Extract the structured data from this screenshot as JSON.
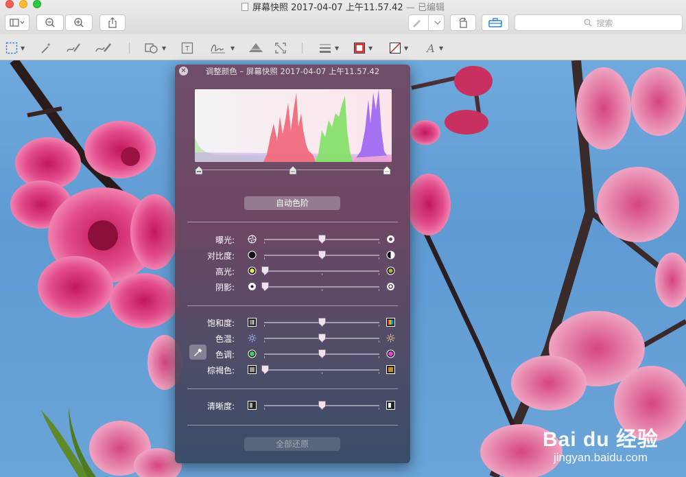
{
  "window": {
    "title": "屏幕快照 2017-04-07 上午11.57.42",
    "edited": " — 已编辑"
  },
  "toolbar": {
    "search_placeholder": "搜索"
  },
  "panel": {
    "title": "调整颜色 – 屏幕快照 2017-04-07 上午11.57.42",
    "auto_levels": "自动色阶",
    "reset_all": "全部还原",
    "levels": {
      "black": 0.0,
      "mid": 0.5,
      "white": 1.0
    },
    "sliders_group1": [
      {
        "label": "曝光:",
        "value": 0.5,
        "icon_left": "aperture-small-icon",
        "icon_right": "aperture-large-icon"
      },
      {
        "label": "对比度:",
        "value": 0.5,
        "icon_left": "contrast-low-icon",
        "icon_right": "contrast-high-icon"
      },
      {
        "label": "高光:",
        "value": 0.0,
        "icon_left": "highlight-bright-icon",
        "icon_right": "highlight-dim-icon"
      },
      {
        "label": "阴影:",
        "value": 0.0,
        "icon_left": "shadow-dark-icon",
        "icon_right": "shadow-light-icon"
      }
    ],
    "sliders_group2": [
      {
        "label": "饱和度:",
        "value": 0.5,
        "icon_left": "saturation-gray-icon",
        "icon_right": "saturation-color-icon"
      },
      {
        "label": "色温:",
        "value": 0.5,
        "icon_left": "temperature-cool-icon",
        "icon_right": "temperature-warm-icon"
      },
      {
        "label": "色调:",
        "value": 0.5,
        "icon_left": "tint-green-icon",
        "icon_right": "tint-magenta-icon"
      },
      {
        "label": "棕褐色:",
        "value": 0.0,
        "icon_left": "sepia-off-icon",
        "icon_right": "sepia-on-icon"
      }
    ],
    "sliders_group3": [
      {
        "label": "清晰度:",
        "value": 0.5,
        "icon_left": "sharpness-low-icon",
        "icon_right": "sharpness-high-icon"
      }
    ]
  },
  "watermark": {
    "logo": "Bai du 经验",
    "url": "jingyan.baidu.com"
  }
}
